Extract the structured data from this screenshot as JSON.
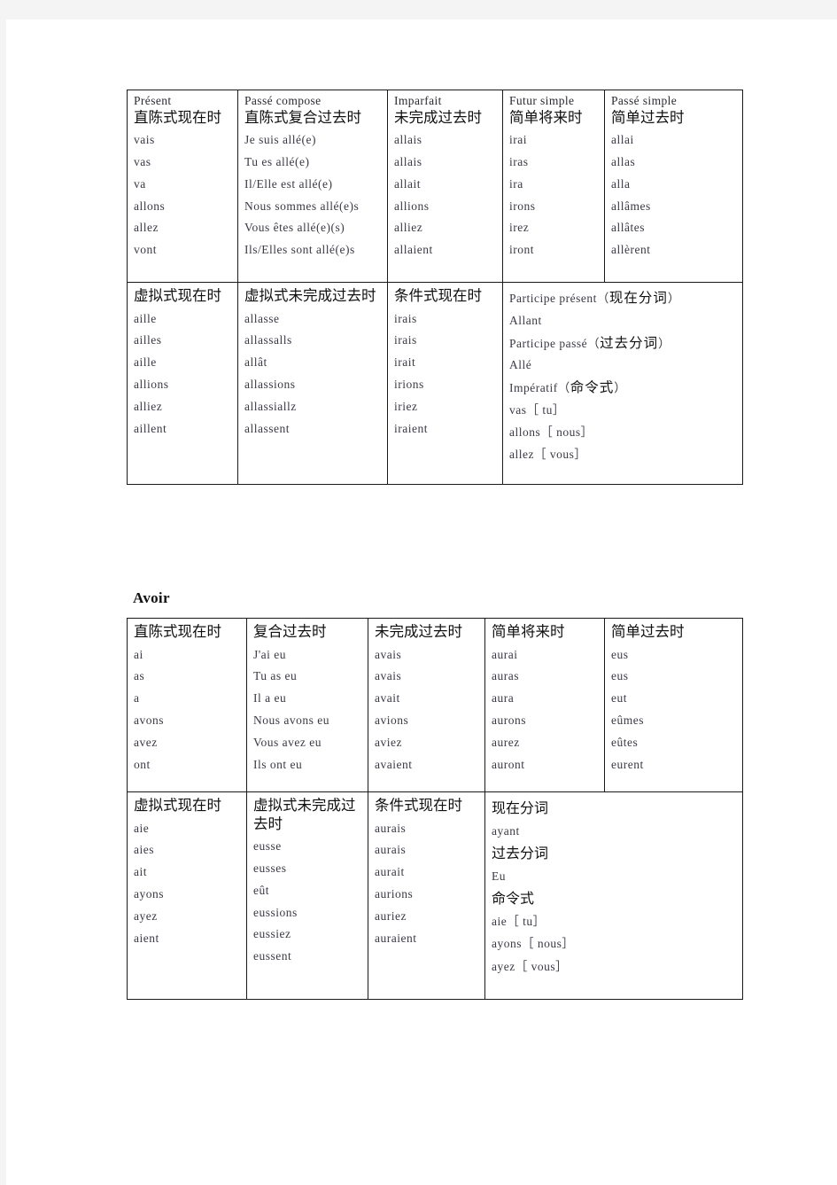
{
  "page": {
    "background": "#ffffff",
    "margin_band_color": "#f4f4f4",
    "border_color": "#1a1a1a"
  },
  "tables": [
    {
      "id": "aller",
      "title": "",
      "row1": [
        {
          "head_fr": "Présent",
          "head_cn": "直陈式现在时",
          "forms": [
            "vais",
            "vas",
            "va",
            "allons",
            "allez",
            "vont"
          ]
        },
        {
          "head_fr": "Passé compose",
          "head_cn": "直陈式复合过去时",
          "forms": [
            "Je suis allé(e)",
            "Tu es allé(e)",
            "Il/Elle est allé(e)",
            "Nous sommes allé(e)s",
            "Vous êtes allé(e)(s)",
            "Ils/Elles sont allé(e)s"
          ]
        },
        {
          "head_fr": "Imparfait",
          "head_cn": "未完成过去时",
          "forms": [
            "allais",
            "allais",
            "allait",
            "allions",
            "alliez",
            "allaient"
          ]
        },
        {
          "head_fr": "Futur simple",
          "head_cn": "简单将来时",
          "forms": [
            "irai",
            "iras",
            "ira",
            "irons",
            "irez",
            "iront"
          ]
        },
        {
          "head_fr": "Passé simple",
          "head_cn": "简单过去时",
          "forms": [
            "allai",
            "allas",
            "alla",
            "allâmes",
            "allâtes",
            "allèrent"
          ]
        }
      ],
      "row2": [
        {
          "head_fr": "",
          "head_cn": "虚拟式现在时",
          "forms": [
            "aille",
            "ailles",
            "aille",
            "allions",
            "alliez",
            "aillent"
          ]
        },
        {
          "head_fr": "",
          "head_cn": "虚拟式未完成过去时",
          "forms": [
            "allasse",
            "allassalls",
            "allât",
            "allassions",
            "allassiallz",
            "allassent"
          ]
        },
        {
          "head_fr": "",
          "head_cn": "条件式现在时",
          "forms": [
            "irais",
            "irais",
            "irait",
            "irions",
            "iriez",
            "iraient"
          ]
        },
        {
          "merged": true,
          "lines": [
            {
              "fr": "Participe présent（",
              "cn": "现在分词",
              "fr_end": "）"
            },
            {
              "fr": "Allant",
              "cn": "",
              "fr_end": ""
            },
            {
              "fr": "Participe passé（",
              "cn": "过去分词",
              "fr_end": "）"
            },
            {
              "fr": "Allé",
              "cn": "",
              "fr_end": ""
            },
            {
              "fr": "Impératif（",
              "cn": "命令式",
              "fr_end": "）"
            },
            {
              "fr": "vas［ tu］",
              "cn": "",
              "fr_end": ""
            },
            {
              "fr": "allons［ nous］",
              "cn": "",
              "fr_end": ""
            },
            {
              "fr": "allez［ vous］",
              "cn": "",
              "fr_end": ""
            }
          ]
        }
      ]
    },
    {
      "id": "avoir",
      "title": "Avoir",
      "row1": [
        {
          "head_fr": "",
          "head_cn": "直陈式现在时",
          "forms": [
            "ai",
            "as",
            "a",
            "avons",
            "avez",
            "ont"
          ]
        },
        {
          "head_fr": "",
          "head_cn": "复合过去时",
          "forms": [
            "J'ai eu",
            "Tu as eu",
            "Il a eu",
            "Nous avons eu",
            "Vous avez eu",
            "Ils ont eu"
          ]
        },
        {
          "head_fr": "",
          "head_cn": "未完成过去时",
          "forms": [
            "avais",
            "avais",
            "avait",
            "avions",
            "aviez",
            "avaient"
          ]
        },
        {
          "head_fr": "",
          "head_cn": "简单将来时",
          "forms": [
            "aurai",
            "auras",
            "aura",
            "aurons",
            "aurez",
            "auront"
          ]
        },
        {
          "head_fr": "",
          "head_cn": "简单过去时",
          "forms": [
            "eus",
            "eus",
            "eut",
            "eûmes",
            "eûtes",
            "eurent"
          ]
        }
      ],
      "row2": [
        {
          "head_fr": "",
          "head_cn": "虚拟式现在时",
          "forms": [
            "aie",
            "aies",
            "ait",
            "ayons",
            "ayez",
            "aient"
          ]
        },
        {
          "head_fr": "",
          "head_cn": "虚拟式未完成过去时",
          "forms": [
            "eusse",
            "eusses",
            "eût",
            "eussions",
            "eussiez",
            "eussent"
          ]
        },
        {
          "head_fr": "",
          "head_cn": "条件式现在时",
          "forms": [
            "aurais",
            "aurais",
            "aurait",
            "aurions",
            "auriez",
            "auraient"
          ]
        },
        {
          "merged": true,
          "lines": [
            {
              "fr": "",
              "cn": "现在分词",
              "fr_end": ""
            },
            {
              "fr": "ayant",
              "cn": "",
              "fr_end": ""
            },
            {
              "fr": "",
              "cn": "过去分词",
              "fr_end": ""
            },
            {
              "fr": "Eu",
              "cn": "",
              "fr_end": ""
            },
            {
              "fr": "",
              "cn": "命令式",
              "fr_end": ""
            },
            {
              "fr": "aie［ tu］",
              "cn": "",
              "fr_end": ""
            },
            {
              "fr": "ayons［ nous］",
              "cn": "",
              "fr_end": ""
            },
            {
              "fr": "ayez［ vous］",
              "cn": "",
              "fr_end": ""
            }
          ]
        }
      ]
    }
  ]
}
